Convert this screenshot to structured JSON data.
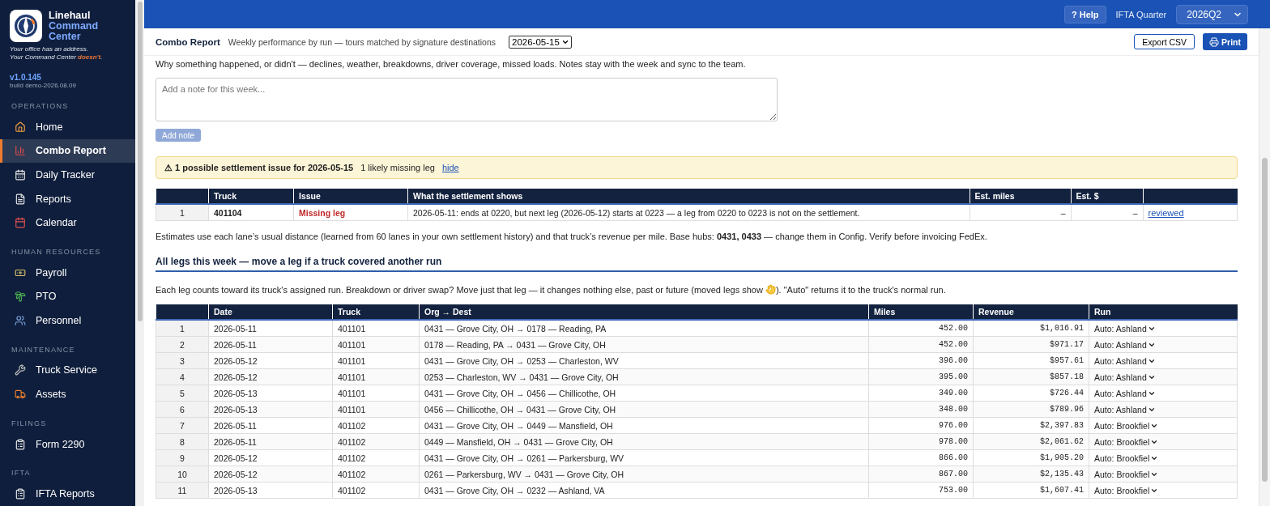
{
  "brand": {
    "line1": "Linehaul",
    "line2": "Command",
    "line3": "Center",
    "tagline_a": "Your office has an address.",
    "tagline_b": "Your Command Center **doesn't**.",
    "version": "v1.0.145",
    "build": "build demo-2026.08.09"
  },
  "sidebar": {
    "sections": [
      {
        "title": "OPERATIONS",
        "items": [
          {
            "label": "Home",
            "kind": "home",
            "selected": false
          },
          {
            "label": "Combo Report",
            "kind": "chart",
            "selected": true
          },
          {
            "label": "Daily Tracker",
            "kind": "tracker",
            "selected": false
          },
          {
            "label": "Reports",
            "kind": "doc",
            "selected": false
          },
          {
            "label": "Calendar",
            "kind": "calendar",
            "selected": false
          }
        ]
      },
      {
        "title": "HUMAN RESOURCES",
        "items": [
          {
            "label": "Payroll",
            "kind": "money",
            "selected": false
          },
          {
            "label": "PTO",
            "kind": "palm",
            "selected": false
          },
          {
            "label": "Personnel",
            "kind": "people",
            "selected": false
          }
        ]
      },
      {
        "title": "MAINTENANCE",
        "items": [
          {
            "label": "Truck Service",
            "kind": "wrench",
            "selected": false
          },
          {
            "label": "Assets",
            "kind": "truck",
            "selected": false
          }
        ]
      },
      {
        "title": "FILINGS",
        "items": [
          {
            "label": "Form 2290",
            "kind": "form",
            "selected": false
          }
        ]
      },
      {
        "title": "IFTA",
        "items": [
          {
            "label": "IFTA Reports",
            "kind": "form",
            "selected": false
          }
        ]
      }
    ]
  },
  "topbar": {
    "help": "? Help",
    "quarter_label": "IFTA Quarter",
    "quarter": "2026Q2"
  },
  "header": {
    "title": "Combo Report",
    "subtitle": "Weekly performance by run — tours matched by signature destinations",
    "week": "2026-05-15",
    "export": "Export CSV",
    "print": "Print"
  },
  "notes": {
    "intro": "Why something happened, or didn't — declines, weather, breakdowns, driver coverage, missed loads. Notes stay with the week and sync to the team.",
    "placeholder": "Add a note for this week...",
    "button": "Add note",
    "button_disabled": true
  },
  "alert": {
    "icon": "⚠",
    "title": "1 possible settlement issue for 2026-05-15",
    "detail": "1 likely missing leg",
    "link": "hide"
  },
  "issues": {
    "columns": [
      "",
      "Truck",
      "Issue",
      "What the settlement shows",
      "Est. miles",
      "Est. $",
      ""
    ],
    "rows": [
      {
        "index": "1",
        "truck": "401104",
        "issue": "Missing leg",
        "shows": "2026-05-11: ends at 0220, but next leg (2026-05-12) starts at 0223 — a leg from 0220 to 0223 is not on the settlement.",
        "miles": "–",
        "dollars": "–",
        "action": "reviewed"
      }
    ]
  },
  "estimates_note": "Estimates use each lane’s usual distance (learned from 60 lanes in your own settlement history) and that truck’s revenue per mile. Base hubs: **0431, 0433** — change them in Config. Verify before invoicing FedEx.",
  "legs": {
    "title": "All legs this week — move a leg if a truck covered another run",
    "help_before": "Each leg counts toward its truck's assigned run. Breakdown or driver swap? Move just that leg — it changes nothing else, past or future (moved legs show",
    "help_after": "). \"Auto\" returns it to the truck's normal run.",
    "columns": [
      "",
      "Date",
      "Truck",
      "Org → Dest",
      "Miles",
      "Revenue",
      "Run"
    ],
    "rows": [
      {
        "index": "1",
        "date": "2026-05-11",
        "truck": "401101",
        "route": "0431 — Grove City, OH → 0178 — Reading, PA",
        "miles": "452.00",
        "revenue": "$1,016.91",
        "run": "Auto: Ashland"
      },
      {
        "index": "2",
        "date": "2026-05-11",
        "truck": "401101",
        "route": "0178 — Reading, PA → 0431 — Grove City, OH",
        "miles": "452.00",
        "revenue": "$971.17",
        "run": "Auto: Ashland"
      },
      {
        "index": "3",
        "date": "2026-05-12",
        "truck": "401101",
        "route": "0431 — Grove City, OH → 0253 — Charleston, WV",
        "miles": "396.00",
        "revenue": "$957.61",
        "run": "Auto: Ashland"
      },
      {
        "index": "4",
        "date": "2026-05-12",
        "truck": "401101",
        "route": "0253 — Charleston, WV → 0431 — Grove City, OH",
        "miles": "395.00",
        "revenue": "$857.18",
        "run": "Auto: Ashland"
      },
      {
        "index": "5",
        "date": "2026-05-13",
        "truck": "401101",
        "route": "0431 — Grove City, OH → 0456 — Chillicothe, OH",
        "miles": "349.00",
        "revenue": "$726.44",
        "run": "Auto: Ashland"
      },
      {
        "index": "6",
        "date": "2026-05-13",
        "truck": "401101",
        "route": "0456 — Chillicothe, OH → 0431 — Grove City, OH",
        "miles": "348.00",
        "revenue": "$789.96",
        "run": "Auto: Ashland"
      },
      {
        "index": "7",
        "date": "2026-05-11",
        "truck": "401102",
        "route": "0431 — Grove City, OH → 0449 — Mansfield, OH",
        "miles": "976.00",
        "revenue": "$2,397.83",
        "run": "Auto: Brookfiel"
      },
      {
        "index": "8",
        "date": "2026-05-11",
        "truck": "401102",
        "route": "0449 — Mansfield, OH → 0431 — Grove City, OH",
        "miles": "978.00",
        "revenue": "$2,061.62",
        "run": "Auto: Brookfiel"
      },
      {
        "index": "9",
        "date": "2026-05-12",
        "truck": "401102",
        "route": "0431 — Grove City, OH → 0261 — Parkersburg, WV",
        "miles": "866.00",
        "revenue": "$1,905.20",
        "run": "Auto: Brookfiel"
      },
      {
        "index": "10",
        "date": "2026-05-12",
        "truck": "401102",
        "route": "0261 — Parkersburg, WV → 0431 — Grove City, OH",
        "miles": "867.00",
        "revenue": "$2,135.43",
        "run": "Auto: Brookfiel"
      },
      {
        "index": "11",
        "date": "2026-05-13",
        "truck": "401102",
        "route": "0431 — Grove City, OH → 0232 — Ashland, VA",
        "miles": "753.00",
        "revenue": "$1,607.41",
        "run": "Auto: Brookfiel"
      }
    ]
  }
}
